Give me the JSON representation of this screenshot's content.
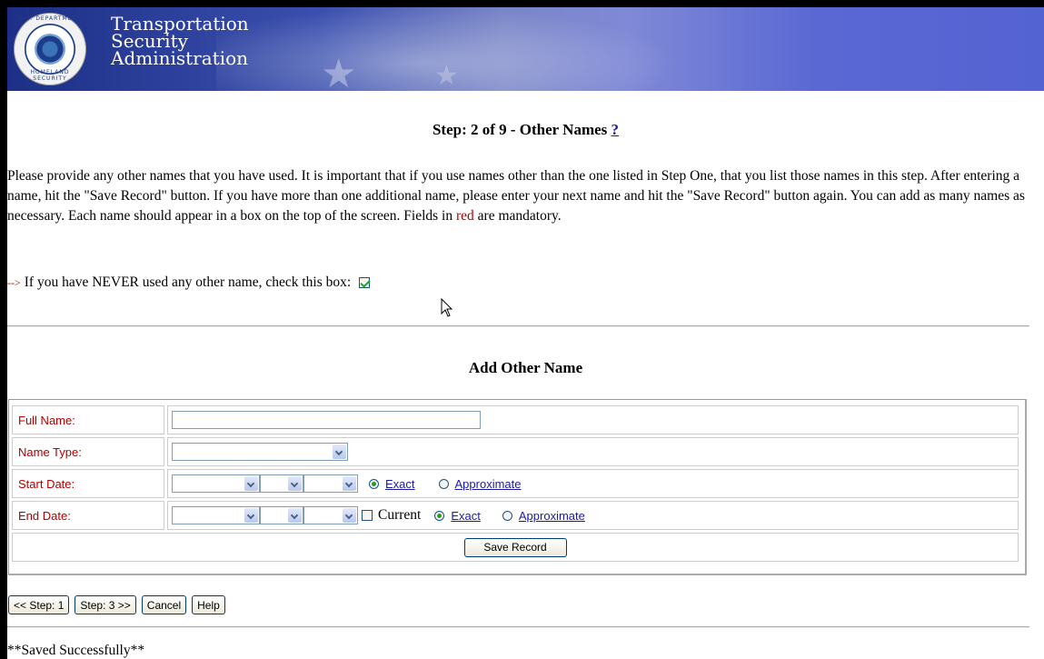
{
  "header": {
    "agency_lines": [
      "Transportation",
      "Security",
      "Administration"
    ],
    "seal_top_text": "U.S. DEPARTMENT",
    "seal_bottom_text": "HOMELAND SECURITY"
  },
  "step": {
    "title": "Step: 2 of 9 - Other Names",
    "help_link": "?"
  },
  "intro": {
    "text_before_red": "Please provide any other names that you have used. It is important that if you use names other than the one listed in Step One, that you list those names in this step. After entering a name, hit the \"Save Record\" button. If you have more than one additional name, please enter your next name and hit the \"Save Record\" button again. You can add as many names as necessary. Each name should appear in a box on the top of the screen. Fields in ",
    "red_word": "red",
    "text_after_red": " are mandatory."
  },
  "never_used": {
    "arrow": "-->",
    "label": "If you have NEVER used any other name, check this box:",
    "checked": true
  },
  "form": {
    "title": "Add Other Name",
    "full_name_label": "Full Name:",
    "full_name_value": "",
    "name_type_label": "Name Type:",
    "start_date_label": "Start Date:",
    "end_date_label": "End Date:",
    "current_label": "Current",
    "exact_label": "Exact",
    "approximate_label": "Approximate",
    "save_label": "Save Record"
  },
  "nav": {
    "prev_label": "<< Step: 1",
    "next_label": "Step: 3 >>",
    "cancel_label": "Cancel",
    "help_label": "Help"
  },
  "status": {
    "message": "**Saved Successfully**"
  },
  "colors": {
    "mandatory_red": "#b00000",
    "link_blue": "#1a1aa6",
    "banner_blue": "#3a4fae"
  }
}
